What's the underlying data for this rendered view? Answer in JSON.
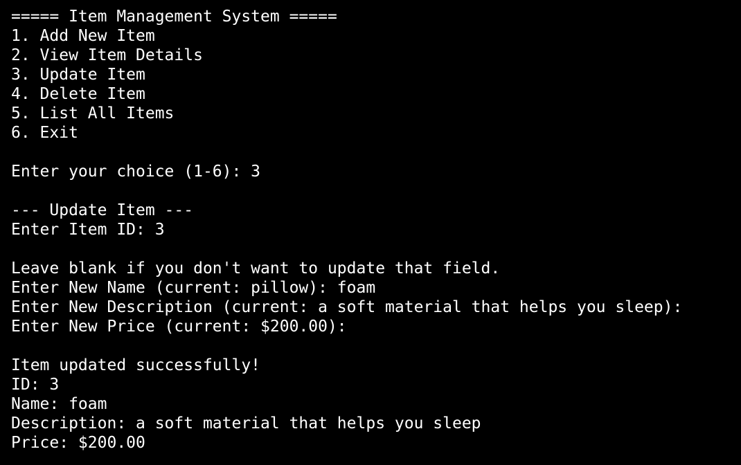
{
  "terminal": {
    "background": "#000000",
    "foreground": "#ffffff",
    "lines": [
      "===== Item Management System =====",
      "1. Add New Item",
      "2. View Item Details",
      "3. Update Item",
      "4. Delete Item",
      "5. List All Items",
      "6. Exit",
      "",
      "Enter your choice (1-6): 3",
      "",
      "--- Update Item ---",
      "Enter Item ID: 3",
      "",
      "Leave blank if you don't want to update that field.",
      "Enter New Name (current: pillow): foam",
      "Enter New Description (current: a soft material that helps you sleep):",
      "Enter New Price (current: $200.00):",
      "",
      "Item updated successfully!",
      "ID: 3",
      "Name: foam",
      "Description: a soft material that helps you sleep",
      "Price: $200.00"
    ]
  }
}
